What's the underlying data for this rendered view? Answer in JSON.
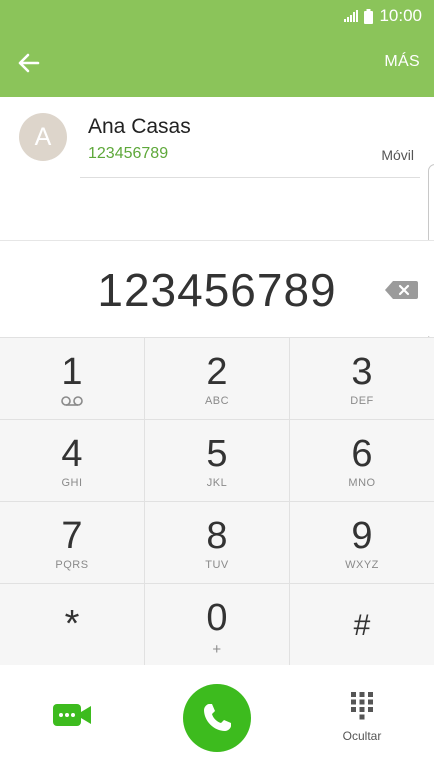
{
  "status_bar": {
    "time": "10:00",
    "signal_icon": "signal-icon",
    "battery_icon": "battery-icon"
  },
  "app_bar": {
    "back_icon": "arrow-left-icon",
    "more_label": "MÁS",
    "color": "#8bc45a"
  },
  "contact": {
    "avatar_letter": "A",
    "name": "Ana Casas",
    "number": "123456789",
    "type": "Móvil",
    "number_color": "#5ea83a"
  },
  "dialer": {
    "number": "123456789",
    "backspace_icon": "backspace-icon"
  },
  "keypad": {
    "keys": [
      {
        "digit": "1",
        "letters": "",
        "icon": "voicemail-icon"
      },
      {
        "digit": "2",
        "letters": "ABC"
      },
      {
        "digit": "3",
        "letters": "DEF"
      },
      {
        "digit": "4",
        "letters": "GHI"
      },
      {
        "digit": "5",
        "letters": "JKL"
      },
      {
        "digit": "6",
        "letters": "MNO"
      },
      {
        "digit": "7",
        "letters": "PQRS"
      },
      {
        "digit": "8",
        "letters": "TUV"
      },
      {
        "digit": "9",
        "letters": "WXYZ"
      },
      {
        "digit": "*",
        "letters": ""
      },
      {
        "digit": "0",
        "letters": "+"
      },
      {
        "digit": "#",
        "letters": ""
      }
    ]
  },
  "bottom_bar": {
    "video_call_icon": "video-call-icon",
    "call_icon": "phone-icon",
    "call_color": "#3dbb1e",
    "hide_icon": "dialpad-icon",
    "hide_label": "Ocultar"
  }
}
